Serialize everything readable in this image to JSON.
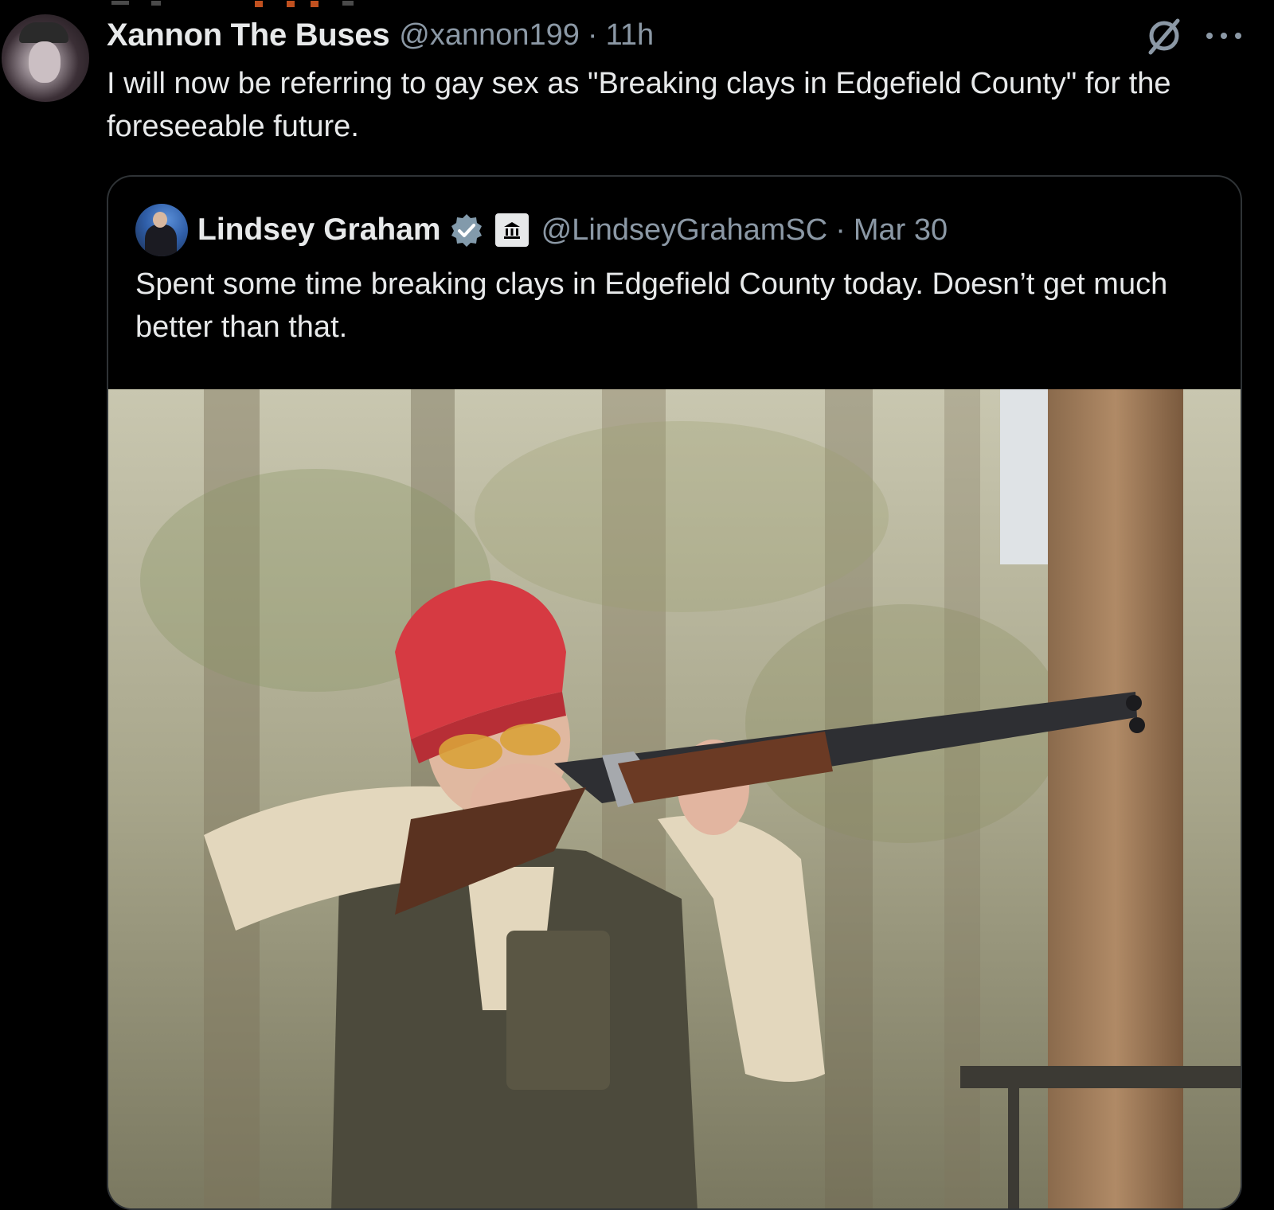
{
  "tweet": {
    "author_name": "Xannon The Buses",
    "handle": "@xannon199",
    "time": "11h",
    "text": "I will now be referring to gay sex as \"Breaking clays in Edgefield County\" for the foreseeable future."
  },
  "quoted_tweet": {
    "author_name": "Lindsey Graham",
    "handle": "@LindseyGrahamSC",
    "time": "Mar 30",
    "text": "Spent some time breaking clays in Edgefield County today. Doesn’t get much better than that.",
    "photo_alt_icon": "photo-trap-shooter",
    "verified_color": "#829aab"
  },
  "icons": {
    "grok": "grok-icon",
    "more": "more-options-icon",
    "verified": "verified-badge-icon",
    "government": "government-building-icon"
  },
  "colors": {
    "background": "#000000",
    "primary_text": "#e7e9ea",
    "secondary_text": "#8b98a5",
    "border": "#2f3336"
  }
}
